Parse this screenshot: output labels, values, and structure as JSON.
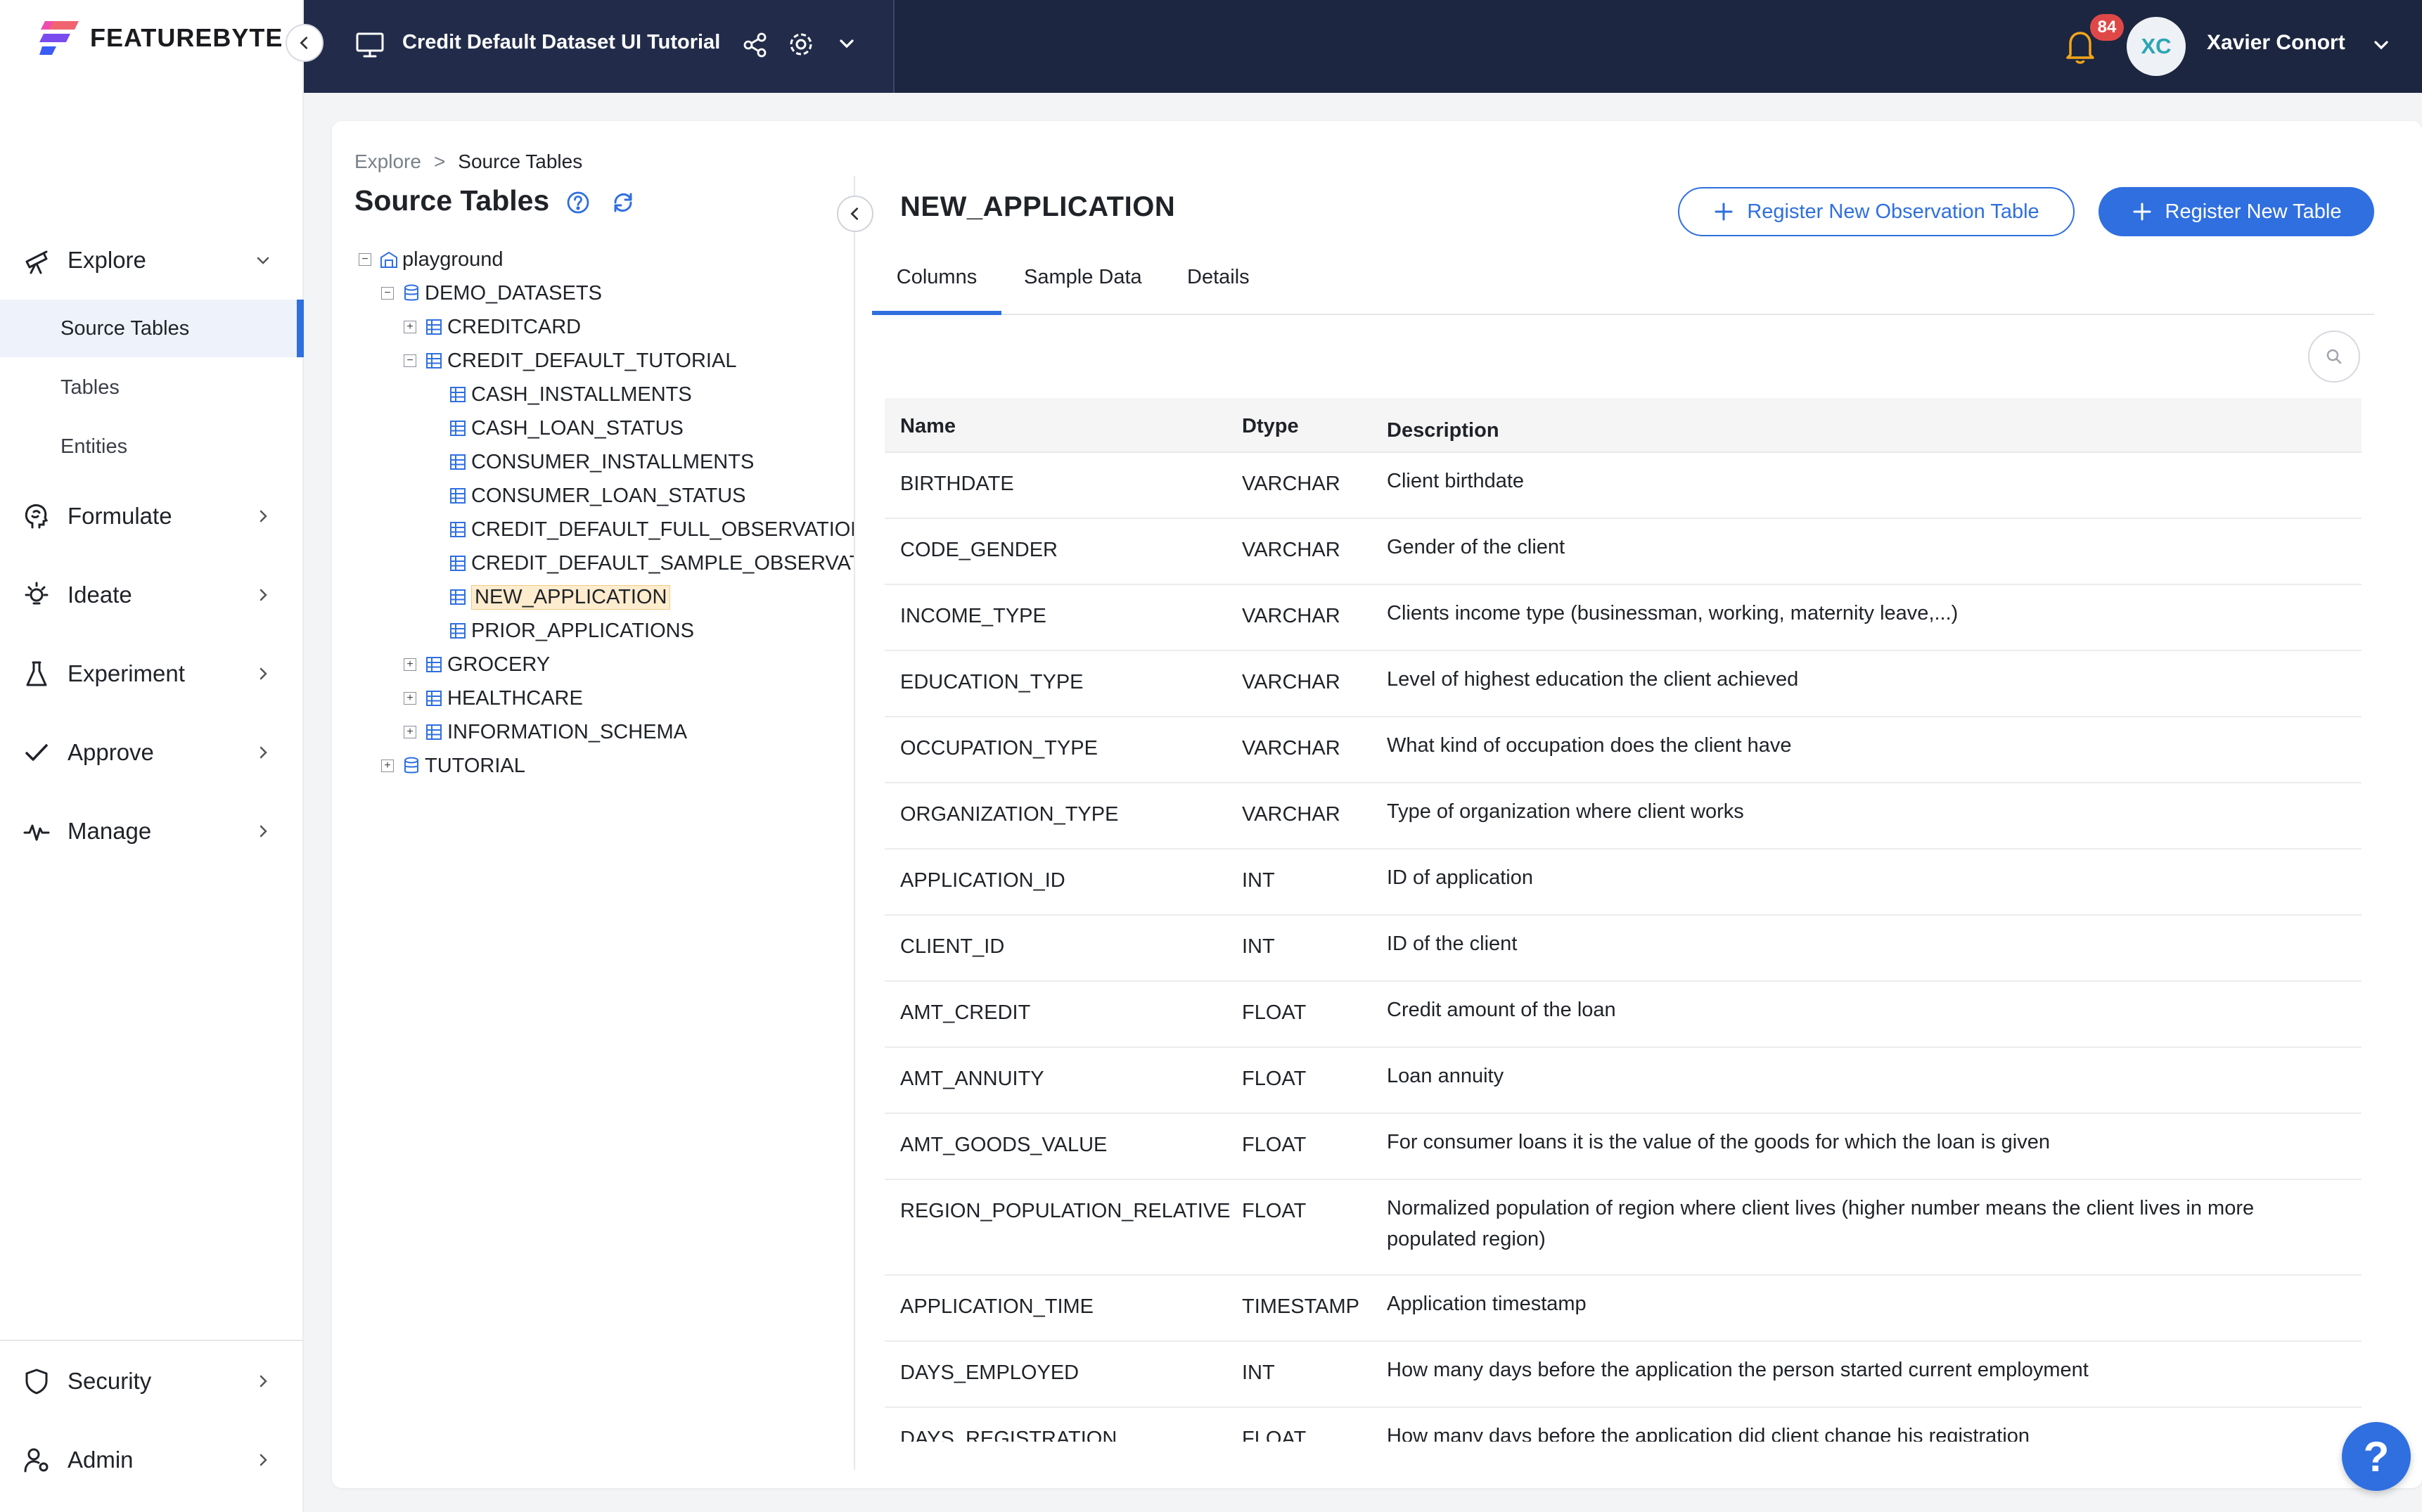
{
  "brand": {
    "name": "FEATUREBYTE"
  },
  "header": {
    "catalog_title": "Credit Default Dataset UI Tutorial",
    "notifications_count": "84",
    "user_initials": "XC",
    "user_name": "Xavier Conort"
  },
  "sidebar": {
    "sections": [
      {
        "label": "Explore",
        "icon": "telescope-icon",
        "expanded": true
      },
      {
        "label": "Formulate",
        "icon": "brain-icon"
      },
      {
        "label": "Ideate",
        "icon": "lightbulb-icon"
      },
      {
        "label": "Experiment",
        "icon": "flask-icon"
      },
      {
        "label": "Approve",
        "icon": "check-icon"
      },
      {
        "label": "Manage",
        "icon": "pulse-icon"
      }
    ],
    "explore_items": [
      {
        "label": "Source Tables",
        "active": true
      },
      {
        "label": "Tables"
      },
      {
        "label": "Entities"
      }
    ],
    "bottom": [
      {
        "label": "Security",
        "icon": "shield-icon"
      },
      {
        "label": "Admin",
        "icon": "user-gear-icon"
      }
    ]
  },
  "breadcrumb": {
    "root": "Explore",
    "separator": ">",
    "current": "Source Tables"
  },
  "tree": {
    "title": "Source Tables",
    "nodes": [
      {
        "label": "playground",
        "type": "catalog",
        "toggle": "−"
      },
      {
        "label": "DEMO_DATASETS",
        "type": "database",
        "toggle": "−"
      },
      {
        "label": "CREDITCARD",
        "type": "schema",
        "toggle": "+"
      },
      {
        "label": "CREDIT_DEFAULT_TUTORIAL",
        "type": "schema",
        "toggle": "−"
      },
      {
        "label": "CASH_INSTALLMENTS",
        "type": "table"
      },
      {
        "label": "CASH_LOAN_STATUS",
        "type": "table"
      },
      {
        "label": "CONSUMER_INSTALLMENTS",
        "type": "table"
      },
      {
        "label": "CONSUMER_LOAN_STATUS",
        "type": "table"
      },
      {
        "label": "CREDIT_DEFAULT_FULL_OBSERVATIONS",
        "type": "table"
      },
      {
        "label": "CREDIT_DEFAULT_SAMPLE_OBSERVATIONS",
        "type": "table"
      },
      {
        "label": "NEW_APPLICATION",
        "type": "table",
        "selected": true
      },
      {
        "label": "PRIOR_APPLICATIONS",
        "type": "table"
      },
      {
        "label": "GROCERY",
        "type": "schema",
        "toggle": "+"
      },
      {
        "label": "HEALTHCARE",
        "type": "schema",
        "toggle": "+"
      },
      {
        "label": "INFORMATION_SCHEMA",
        "type": "schema",
        "toggle": "+"
      },
      {
        "label": "TUTORIAL",
        "type": "database",
        "toggle": "+"
      }
    ]
  },
  "detail": {
    "title": "NEW_APPLICATION",
    "register_observation_label": "Register New Observation Table",
    "register_table_label": "Register New Table",
    "tabs": [
      {
        "label": "Columns",
        "active": true
      },
      {
        "label": "Sample Data"
      },
      {
        "label": "Details"
      }
    ],
    "columns_header": {
      "name": "Name",
      "dtype": "Dtype",
      "description": "Description"
    },
    "rows": [
      {
        "name": "BIRTHDATE",
        "dtype": "VARCHAR",
        "description": "Client birthdate"
      },
      {
        "name": "CODE_GENDER",
        "dtype": "VARCHAR",
        "description": "Gender of the client"
      },
      {
        "name": "INCOME_TYPE",
        "dtype": "VARCHAR",
        "description": "Clients income type (businessman, working, maternity leave,...)"
      },
      {
        "name": "EDUCATION_TYPE",
        "dtype": "VARCHAR",
        "description": "Level of highest education the client achieved"
      },
      {
        "name": "OCCUPATION_TYPE",
        "dtype": "VARCHAR",
        "description": "What kind of occupation does the client have"
      },
      {
        "name": "ORGANIZATION_TYPE",
        "dtype": "VARCHAR",
        "description": "Type of organization where client works"
      },
      {
        "name": "APPLICATION_ID",
        "dtype": "INT",
        "description": "ID of application"
      },
      {
        "name": "CLIENT_ID",
        "dtype": "INT",
        "description": "ID of the client"
      },
      {
        "name": "AMT_CREDIT",
        "dtype": "FLOAT",
        "description": "Credit amount of the loan"
      },
      {
        "name": "AMT_ANNUITY",
        "dtype": "FLOAT",
        "description": "Loan annuity"
      },
      {
        "name": "AMT_GOODS_VALUE",
        "dtype": "FLOAT",
        "description": "For consumer loans it is the value of the goods for which the loan is given"
      },
      {
        "name": "REGION_POPULATION_RELATIVE",
        "dtype": "FLOAT",
        "description": "Normalized population of region where client lives (higher number means the client lives in more populated region)"
      },
      {
        "name": "APPLICATION_TIME",
        "dtype": "TIMESTAMP",
        "description": "Application timestamp"
      },
      {
        "name": "DAYS_EMPLOYED",
        "dtype": "INT",
        "description": "How many days before the application the person started current employment"
      },
      {
        "name": "DAYS_REGISTRATION",
        "dtype": "FLOAT",
        "description": "How many days before the application did client change his registration"
      }
    ]
  },
  "help_fab": {
    "label": "?"
  },
  "colors": {
    "topbar": "#1d2640",
    "accent": "#2f6fe0",
    "badge": "#e04848",
    "selected_node": "#fdeccd"
  }
}
